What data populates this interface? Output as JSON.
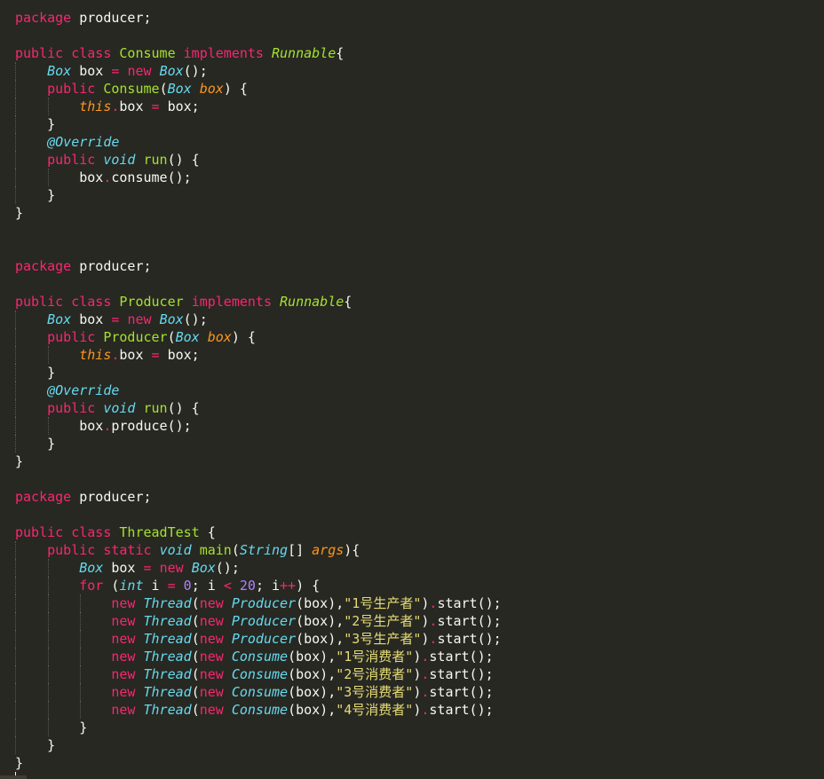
{
  "colors": {
    "background": "#272822",
    "keyword": "#f92672",
    "type": "#66d9ef",
    "class": "#a6e22e",
    "param": "#fd971f",
    "string": "#e6db74",
    "number": "#ae81ff",
    "text": "#f8f8f2"
  },
  "lines": [
    {
      "indent": 0,
      "tokens": [
        {
          "t": "kw",
          "v": "package"
        },
        {
          "t": "plain",
          "v": " producer;"
        }
      ]
    },
    {
      "indent": 0,
      "tokens": []
    },
    {
      "indent": 0,
      "tokens": [
        {
          "t": "kw",
          "v": "public"
        },
        {
          "t": "plain",
          "v": " "
        },
        {
          "t": "kw",
          "v": "class"
        },
        {
          "t": "plain",
          "v": " "
        },
        {
          "t": "cls",
          "v": "Consume"
        },
        {
          "t": "plain",
          "v": " "
        },
        {
          "t": "kw",
          "v": "implements"
        },
        {
          "t": "plain",
          "v": " "
        },
        {
          "t": "cls-it",
          "v": "Runnable"
        },
        {
          "t": "plain",
          "v": "{"
        }
      ]
    },
    {
      "indent": 1,
      "tokens": [
        {
          "t": "type",
          "v": "Box"
        },
        {
          "t": "plain",
          "v": " box "
        },
        {
          "t": "op",
          "v": "="
        },
        {
          "t": "plain",
          "v": " "
        },
        {
          "t": "kw",
          "v": "new"
        },
        {
          "t": "plain",
          "v": " "
        },
        {
          "t": "type",
          "v": "Box"
        },
        {
          "t": "plain",
          "v": "();"
        }
      ]
    },
    {
      "indent": 1,
      "tokens": [
        {
          "t": "kw",
          "v": "public"
        },
        {
          "t": "plain",
          "v": " "
        },
        {
          "t": "cls",
          "v": "Consume"
        },
        {
          "t": "plain",
          "v": "("
        },
        {
          "t": "type",
          "v": "Box"
        },
        {
          "t": "plain",
          "v": " "
        },
        {
          "t": "param",
          "v": "box"
        },
        {
          "t": "plain",
          "v": ") {"
        }
      ]
    },
    {
      "indent": 2,
      "tokens": [
        {
          "t": "param",
          "v": "this"
        },
        {
          "t": "op",
          "v": "."
        },
        {
          "t": "plain",
          "v": "box "
        },
        {
          "t": "op",
          "v": "="
        },
        {
          "t": "plain",
          "v": " box;"
        }
      ]
    },
    {
      "indent": 1,
      "tokens": [
        {
          "t": "plain",
          "v": "}"
        }
      ]
    },
    {
      "indent": 1,
      "tokens": [
        {
          "t": "type",
          "v": "@Override"
        }
      ]
    },
    {
      "indent": 1,
      "tokens": [
        {
          "t": "kw",
          "v": "public"
        },
        {
          "t": "plain",
          "v": " "
        },
        {
          "t": "type",
          "v": "void"
        },
        {
          "t": "plain",
          "v": " "
        },
        {
          "t": "cls",
          "v": "run"
        },
        {
          "t": "plain",
          "v": "() {"
        }
      ]
    },
    {
      "indent": 2,
      "tokens": [
        {
          "t": "plain",
          "v": "box"
        },
        {
          "t": "op",
          "v": "."
        },
        {
          "t": "plain",
          "v": "consume();"
        }
      ]
    },
    {
      "indent": 1,
      "tokens": [
        {
          "t": "plain",
          "v": "}"
        }
      ]
    },
    {
      "indent": 0,
      "tokens": [
        {
          "t": "plain",
          "v": "}"
        }
      ]
    },
    {
      "indent": 0,
      "tokens": []
    },
    {
      "indent": 0,
      "tokens": []
    },
    {
      "indent": 0,
      "tokens": [
        {
          "t": "kw",
          "v": "package"
        },
        {
          "t": "plain",
          "v": " producer;"
        }
      ]
    },
    {
      "indent": 0,
      "tokens": []
    },
    {
      "indent": 0,
      "tokens": [
        {
          "t": "kw",
          "v": "public"
        },
        {
          "t": "plain",
          "v": " "
        },
        {
          "t": "kw",
          "v": "class"
        },
        {
          "t": "plain",
          "v": " "
        },
        {
          "t": "cls",
          "v": "Producer"
        },
        {
          "t": "plain",
          "v": " "
        },
        {
          "t": "kw",
          "v": "implements"
        },
        {
          "t": "plain",
          "v": " "
        },
        {
          "t": "cls-it",
          "v": "Runnable"
        },
        {
          "t": "plain",
          "v": "{"
        }
      ]
    },
    {
      "indent": 1,
      "tokens": [
        {
          "t": "type",
          "v": "Box"
        },
        {
          "t": "plain",
          "v": " box "
        },
        {
          "t": "op",
          "v": "="
        },
        {
          "t": "plain",
          "v": " "
        },
        {
          "t": "kw",
          "v": "new"
        },
        {
          "t": "plain",
          "v": " "
        },
        {
          "t": "type",
          "v": "Box"
        },
        {
          "t": "plain",
          "v": "();"
        }
      ]
    },
    {
      "indent": 1,
      "tokens": [
        {
          "t": "kw",
          "v": "public"
        },
        {
          "t": "plain",
          "v": " "
        },
        {
          "t": "cls",
          "v": "Producer"
        },
        {
          "t": "plain",
          "v": "("
        },
        {
          "t": "type",
          "v": "Box"
        },
        {
          "t": "plain",
          "v": " "
        },
        {
          "t": "param",
          "v": "box"
        },
        {
          "t": "plain",
          "v": ") {"
        }
      ]
    },
    {
      "indent": 2,
      "tokens": [
        {
          "t": "param",
          "v": "this"
        },
        {
          "t": "op",
          "v": "."
        },
        {
          "t": "plain",
          "v": "box "
        },
        {
          "t": "op",
          "v": "="
        },
        {
          "t": "plain",
          "v": " box;"
        }
      ]
    },
    {
      "indent": 1,
      "tokens": [
        {
          "t": "plain",
          "v": "}"
        }
      ]
    },
    {
      "indent": 1,
      "tokens": [
        {
          "t": "type",
          "v": "@Override"
        }
      ]
    },
    {
      "indent": 1,
      "tokens": [
        {
          "t": "kw",
          "v": "public"
        },
        {
          "t": "plain",
          "v": " "
        },
        {
          "t": "type",
          "v": "void"
        },
        {
          "t": "plain",
          "v": " "
        },
        {
          "t": "cls",
          "v": "run"
        },
        {
          "t": "plain",
          "v": "() {"
        }
      ]
    },
    {
      "indent": 2,
      "tokens": [
        {
          "t": "plain",
          "v": "box"
        },
        {
          "t": "op",
          "v": "."
        },
        {
          "t": "plain",
          "v": "produce();"
        }
      ]
    },
    {
      "indent": 1,
      "tokens": [
        {
          "t": "plain",
          "v": "}"
        }
      ]
    },
    {
      "indent": 0,
      "tokens": [
        {
          "t": "plain",
          "v": "}"
        }
      ]
    },
    {
      "indent": 0,
      "tokens": []
    },
    {
      "indent": 0,
      "tokens": [
        {
          "t": "kw",
          "v": "package"
        },
        {
          "t": "plain",
          "v": " producer;"
        }
      ]
    },
    {
      "indent": 0,
      "tokens": []
    },
    {
      "indent": 0,
      "tokens": [
        {
          "t": "kw",
          "v": "public"
        },
        {
          "t": "plain",
          "v": " "
        },
        {
          "t": "kw",
          "v": "class"
        },
        {
          "t": "plain",
          "v": " "
        },
        {
          "t": "cls",
          "v": "ThreadTest"
        },
        {
          "t": "plain",
          "v": " {"
        }
      ]
    },
    {
      "indent": 1,
      "tokens": [
        {
          "t": "kw",
          "v": "public"
        },
        {
          "t": "plain",
          "v": " "
        },
        {
          "t": "kw",
          "v": "static"
        },
        {
          "t": "plain",
          "v": " "
        },
        {
          "t": "type",
          "v": "void"
        },
        {
          "t": "plain",
          "v": " "
        },
        {
          "t": "cls",
          "v": "main"
        },
        {
          "t": "plain",
          "v": "("
        },
        {
          "t": "type",
          "v": "String"
        },
        {
          "t": "plain",
          "v": "[] "
        },
        {
          "t": "param",
          "v": "args"
        },
        {
          "t": "plain",
          "v": "){"
        }
      ]
    },
    {
      "indent": 2,
      "tokens": [
        {
          "t": "type",
          "v": "Box"
        },
        {
          "t": "plain",
          "v": " box "
        },
        {
          "t": "op",
          "v": "="
        },
        {
          "t": "plain",
          "v": " "
        },
        {
          "t": "kw",
          "v": "new"
        },
        {
          "t": "plain",
          "v": " "
        },
        {
          "t": "type",
          "v": "Box"
        },
        {
          "t": "plain",
          "v": "();"
        }
      ]
    },
    {
      "indent": 2,
      "tokens": [
        {
          "t": "kw",
          "v": "for"
        },
        {
          "t": "plain",
          "v": " ("
        },
        {
          "t": "type",
          "v": "int"
        },
        {
          "t": "plain",
          "v": " i "
        },
        {
          "t": "op",
          "v": "="
        },
        {
          "t": "plain",
          "v": " "
        },
        {
          "t": "num",
          "v": "0"
        },
        {
          "t": "plain",
          "v": "; i "
        },
        {
          "t": "op",
          "v": "<"
        },
        {
          "t": "plain",
          "v": " "
        },
        {
          "t": "num",
          "v": "20"
        },
        {
          "t": "plain",
          "v": "; i"
        },
        {
          "t": "op",
          "v": "++"
        },
        {
          "t": "plain",
          "v": ") {"
        }
      ]
    },
    {
      "indent": 3,
      "tokens": [
        {
          "t": "kw",
          "v": "new"
        },
        {
          "t": "plain",
          "v": " "
        },
        {
          "t": "type",
          "v": "Thread"
        },
        {
          "t": "plain",
          "v": "("
        },
        {
          "t": "kw",
          "v": "new"
        },
        {
          "t": "plain",
          "v": " "
        },
        {
          "t": "type",
          "v": "Producer"
        },
        {
          "t": "plain",
          "v": "(box),"
        },
        {
          "t": "str",
          "v": "\"1号生产者\""
        },
        {
          "t": "plain",
          "v": ")"
        },
        {
          "t": "op",
          "v": "."
        },
        {
          "t": "plain",
          "v": "start();"
        }
      ]
    },
    {
      "indent": 3,
      "tokens": [
        {
          "t": "kw",
          "v": "new"
        },
        {
          "t": "plain",
          "v": " "
        },
        {
          "t": "type",
          "v": "Thread"
        },
        {
          "t": "plain",
          "v": "("
        },
        {
          "t": "kw",
          "v": "new"
        },
        {
          "t": "plain",
          "v": " "
        },
        {
          "t": "type",
          "v": "Producer"
        },
        {
          "t": "plain",
          "v": "(box),"
        },
        {
          "t": "str",
          "v": "\"2号生产者\""
        },
        {
          "t": "plain",
          "v": ")"
        },
        {
          "t": "op",
          "v": "."
        },
        {
          "t": "plain",
          "v": "start();"
        }
      ]
    },
    {
      "indent": 3,
      "tokens": [
        {
          "t": "kw",
          "v": "new"
        },
        {
          "t": "plain",
          "v": " "
        },
        {
          "t": "type",
          "v": "Thread"
        },
        {
          "t": "plain",
          "v": "("
        },
        {
          "t": "kw",
          "v": "new"
        },
        {
          "t": "plain",
          "v": " "
        },
        {
          "t": "type",
          "v": "Producer"
        },
        {
          "t": "plain",
          "v": "(box),"
        },
        {
          "t": "str",
          "v": "\"3号生产者\""
        },
        {
          "t": "plain",
          "v": ")"
        },
        {
          "t": "op",
          "v": "."
        },
        {
          "t": "plain",
          "v": "start();"
        }
      ]
    },
    {
      "indent": 3,
      "tokens": [
        {
          "t": "kw",
          "v": "new"
        },
        {
          "t": "plain",
          "v": " "
        },
        {
          "t": "type",
          "v": "Thread"
        },
        {
          "t": "plain",
          "v": "("
        },
        {
          "t": "kw",
          "v": "new"
        },
        {
          "t": "plain",
          "v": " "
        },
        {
          "t": "type",
          "v": "Consume"
        },
        {
          "t": "plain",
          "v": "(box),"
        },
        {
          "t": "str",
          "v": "\"1号消费者\""
        },
        {
          "t": "plain",
          "v": ")"
        },
        {
          "t": "op",
          "v": "."
        },
        {
          "t": "plain",
          "v": "start();"
        }
      ]
    },
    {
      "indent": 3,
      "tokens": [
        {
          "t": "kw",
          "v": "new"
        },
        {
          "t": "plain",
          "v": " "
        },
        {
          "t": "type",
          "v": "Thread"
        },
        {
          "t": "plain",
          "v": "("
        },
        {
          "t": "kw",
          "v": "new"
        },
        {
          "t": "plain",
          "v": " "
        },
        {
          "t": "type",
          "v": "Consume"
        },
        {
          "t": "plain",
          "v": "(box),"
        },
        {
          "t": "str",
          "v": "\"2号消费者\""
        },
        {
          "t": "plain",
          "v": ")"
        },
        {
          "t": "op",
          "v": "."
        },
        {
          "t": "plain",
          "v": "start();"
        }
      ]
    },
    {
      "indent": 3,
      "tokens": [
        {
          "t": "kw",
          "v": "new"
        },
        {
          "t": "plain",
          "v": " "
        },
        {
          "t": "type",
          "v": "Thread"
        },
        {
          "t": "plain",
          "v": "("
        },
        {
          "t": "kw",
          "v": "new"
        },
        {
          "t": "plain",
          "v": " "
        },
        {
          "t": "type",
          "v": "Consume"
        },
        {
          "t": "plain",
          "v": "(box),"
        },
        {
          "t": "str",
          "v": "\"3号消费者\""
        },
        {
          "t": "plain",
          "v": ")"
        },
        {
          "t": "op",
          "v": "."
        },
        {
          "t": "plain",
          "v": "start();"
        }
      ]
    },
    {
      "indent": 3,
      "tokens": [
        {
          "t": "kw",
          "v": "new"
        },
        {
          "t": "plain",
          "v": " "
        },
        {
          "t": "type",
          "v": "Thread"
        },
        {
          "t": "plain",
          "v": "("
        },
        {
          "t": "kw",
          "v": "new"
        },
        {
          "t": "plain",
          "v": " "
        },
        {
          "t": "type",
          "v": "Consume"
        },
        {
          "t": "plain",
          "v": "(box),"
        },
        {
          "t": "str",
          "v": "\"4号消费者\""
        },
        {
          "t": "plain",
          "v": ")"
        },
        {
          "t": "op",
          "v": "."
        },
        {
          "t": "plain",
          "v": "start();"
        }
      ]
    },
    {
      "indent": 2,
      "tokens": [
        {
          "t": "plain",
          "v": "}"
        }
      ]
    },
    {
      "indent": 1,
      "tokens": [
        {
          "t": "plain",
          "v": "}"
        }
      ]
    },
    {
      "indent": 0,
      "tokens": [
        {
          "t": "plain",
          "v": "}"
        }
      ]
    }
  ]
}
